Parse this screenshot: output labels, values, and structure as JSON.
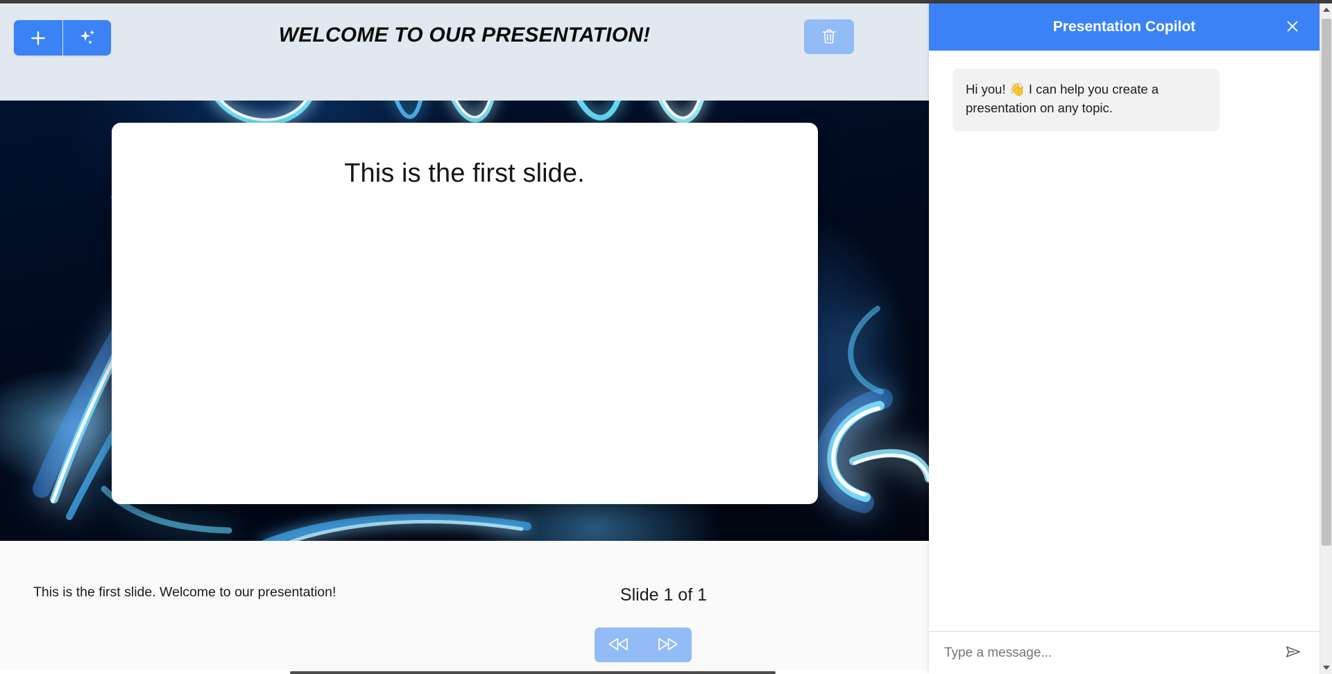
{
  "app": {
    "deck_title": "Welcome to our Presentation!"
  },
  "toolbar": {
    "add_slide_label": "+",
    "add_slide_icon": "plus-icon",
    "ai_generate_icon": "sparkles-icon",
    "delete_icon": "trash-icon"
  },
  "slide": {
    "heading": "This is the first slide.",
    "background": "neon-light-trails"
  },
  "footer": {
    "notes": "This is the first slide. Welcome to our presentation!",
    "counter": "Slide 1 of 1",
    "prev_icon": "rewind-icon",
    "next_icon": "fast-forward-icon"
  },
  "copilot": {
    "title": "Presentation Copilot",
    "close_icon": "close-icon",
    "messages": [
      {
        "role": "assistant",
        "text": "Hi you! 👋 I can help you create a presentation on any topic."
      }
    ],
    "input": {
      "value": "",
      "placeholder": "Type a message..."
    },
    "send_icon": "send-icon"
  },
  "colors": {
    "accent": "#3b82f6",
    "accent_muted": "#93bbf5",
    "header_bg": "#e2e8f0",
    "canvas_bg": "#010a1d",
    "bubble_bg": "#f2f2f3"
  }
}
